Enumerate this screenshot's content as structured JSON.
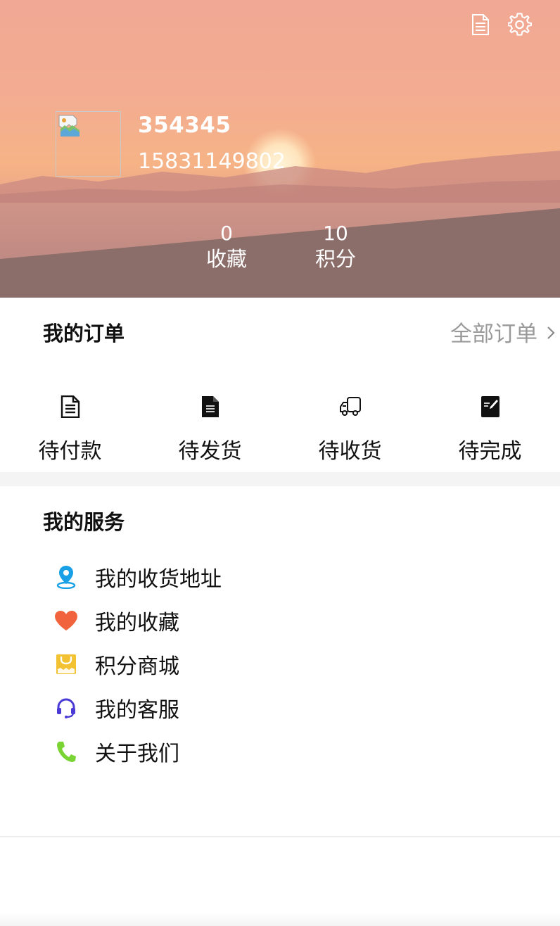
{
  "colors": {
    "header_top": "#f1a895",
    "header_bottom": "#8c6e6a",
    "icon_location": "#1aa0e6",
    "icon_heart": "#f1633c",
    "icon_mall": "#f2c232",
    "icon_support": "#4b3bd6",
    "icon_phone": "#7ad433",
    "divider": "#f4f4f4"
  },
  "header": {
    "icons": [
      "document-icon",
      "settings-gear-icon"
    ],
    "user": {
      "name": "354345",
      "phone": "15831149802"
    },
    "stats": [
      {
        "value": "0",
        "label": "收藏"
      },
      {
        "value": "10",
        "label": "积分"
      }
    ]
  },
  "orders": {
    "title": "我的订单",
    "all_label": "全部订单",
    "items": [
      {
        "label": "待付款",
        "icon": "list-document-icon"
      },
      {
        "label": "待发货",
        "icon": "file-document-icon"
      },
      {
        "label": "待收货",
        "icon": "delivery-truck-icon"
      },
      {
        "label": "待完成",
        "icon": "edit-note-icon"
      }
    ]
  },
  "services": {
    "title": "我的服务",
    "items": [
      {
        "label": "我的收货地址",
        "icon": "location-pin-icon"
      },
      {
        "label": "我的收藏",
        "icon": "heart-icon"
      },
      {
        "label": "积分商城",
        "icon": "shopping-bag-icon"
      },
      {
        "label": "我的客服",
        "icon": "headset-icon"
      },
      {
        "label": "关于我们",
        "icon": "phone-icon"
      }
    ]
  }
}
